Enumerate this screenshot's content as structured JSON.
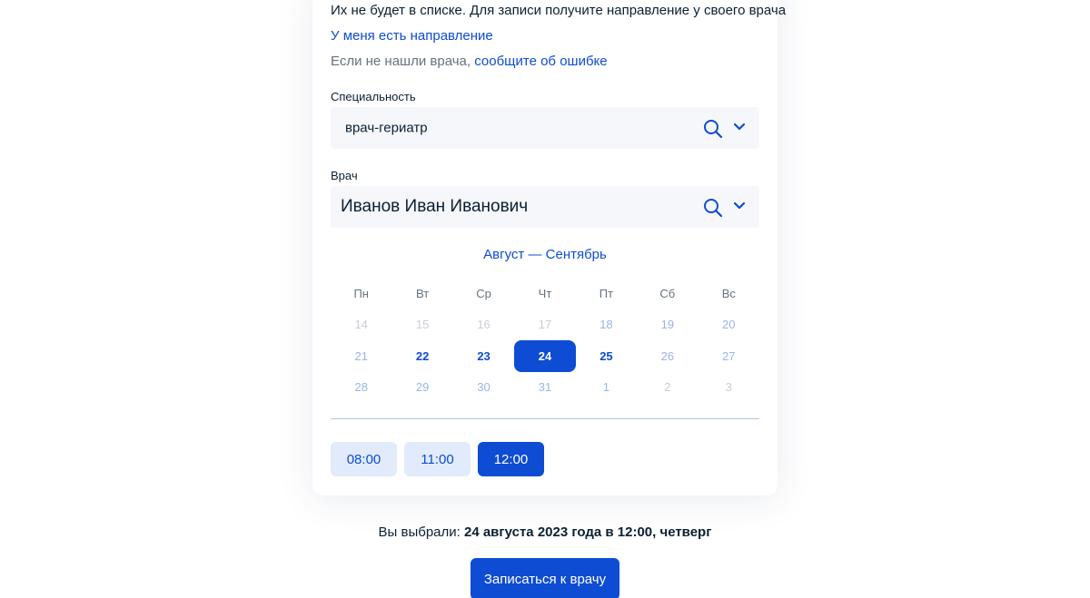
{
  "info": {
    "no_list_text": "Их не будет в списке. Для записи получите направление у своего врача",
    "referral_link": "У меня есть направление",
    "not_found_prefix": "Если не нашли врача,",
    "report_error_link": "сообщите об ошибке"
  },
  "specialty": {
    "label": "Специальность",
    "value": "врач-гериатр"
  },
  "doctor": {
    "label": "Врач",
    "value": "Иванов Иван Иванович"
  },
  "calendar": {
    "months": "Август — Сентябрь",
    "weekdays": [
      "Пн",
      "Вт",
      "Ср",
      "Чт",
      "Пт",
      "Сб",
      "Вс"
    ],
    "days": [
      {
        "n": "14",
        "state": "past"
      },
      {
        "n": "15",
        "state": "past"
      },
      {
        "n": "16",
        "state": "past"
      },
      {
        "n": "17",
        "state": "past"
      },
      {
        "n": "18",
        "state": "off"
      },
      {
        "n": "19",
        "state": "off"
      },
      {
        "n": "20",
        "state": "off"
      },
      {
        "n": "21",
        "state": "off"
      },
      {
        "n": "22",
        "state": "avail"
      },
      {
        "n": "23",
        "state": "avail"
      },
      {
        "n": "24",
        "state": "selected"
      },
      {
        "n": "25",
        "state": "avail"
      },
      {
        "n": "26",
        "state": "off"
      },
      {
        "n": "27",
        "state": "off"
      },
      {
        "n": "28",
        "state": "off"
      },
      {
        "n": "29",
        "state": "off"
      },
      {
        "n": "30",
        "state": "off"
      },
      {
        "n": "31",
        "state": "off"
      },
      {
        "n": "1",
        "state": "off"
      },
      {
        "n": "2",
        "state": "past"
      },
      {
        "n": "3",
        "state": "past"
      }
    ]
  },
  "slots": [
    {
      "time": "08:00",
      "active": false
    },
    {
      "time": "11:00",
      "active": false
    },
    {
      "time": "12:00",
      "active": true
    }
  ],
  "summary": {
    "prefix": "Вы выбрали:",
    "value": "24 августа 2023 года в 12:00, четверг"
  },
  "submit_label": "Записаться к врачу",
  "colors": {
    "accent": "#0d4cd3",
    "field_bg": "#f5f7fa",
    "slot_bg": "#e2ebfb"
  },
  "icons": {
    "search": "search-icon",
    "dropdown": "chevron-down-icon"
  }
}
